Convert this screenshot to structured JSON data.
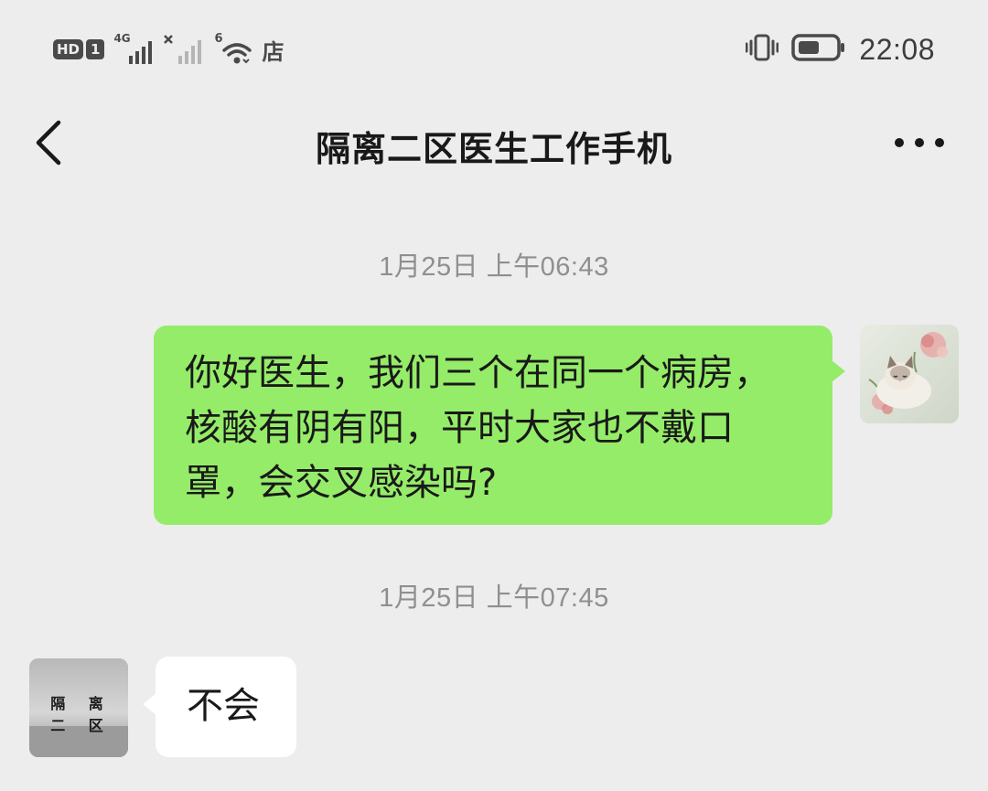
{
  "status_bar": {
    "hd_label": "HD",
    "sim_label": "1",
    "network_label": "4G",
    "wifi_label": "6",
    "store_label": "店",
    "time": "22:08",
    "icons": [
      "hd-icon",
      "signal-icon",
      "signal-weak-icon",
      "wifi-icon",
      "vibrate-icon",
      "battery-icon"
    ]
  },
  "nav": {
    "title": "隔离二区医生工作手机"
  },
  "chat": {
    "messages": [
      {
        "timestamp": "1月25日 上午06:43",
        "sender": "self",
        "lines": [
          "你好医生，我们三个在同一个病房，",
          "核酸有阴有阳，平时大家也不戴口",
          "罩，会交叉感染吗?"
        ]
      },
      {
        "timestamp": "1月25日 上午07:45",
        "sender": "doctor",
        "avatar_label": "隔 离 二 区",
        "text": "不会"
      }
    ]
  },
  "colors": {
    "background": "#ededed",
    "self_bubble": "#95ec69",
    "doctor_bubble": "#ffffff",
    "timestamp": "#8f8f8f"
  }
}
